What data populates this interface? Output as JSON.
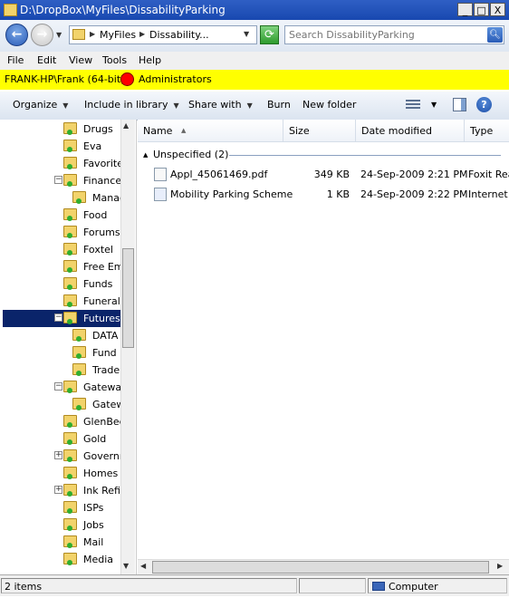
{
  "window": {
    "title": "D:\\DropBox\\MyFiles\\DissabilityParking",
    "minimize_label": "_",
    "maximize_label": "□",
    "close_label": "X"
  },
  "address": {
    "back_glyph": "←",
    "forward_glyph": "→",
    "crumbs": [
      "MyFiles",
      "Dissability..."
    ],
    "search_placeholder": "Search DissabilityParking"
  },
  "menu": [
    "File",
    "Edit",
    "View",
    "Tools",
    "Help"
  ],
  "userbar": {
    "user": "FRANK-HP\\Frank (64-bit)",
    "group": "Administrators",
    "dot_color": "#ff0000"
  },
  "toolbar": {
    "organize": "Organize",
    "include": "Include in library",
    "share": "Share with",
    "burn": "Burn",
    "new_folder": "New folder",
    "help_glyph": "?"
  },
  "tree": [
    {
      "label": "Drugs"
    },
    {
      "label": "Eva"
    },
    {
      "label": "Favorite"
    },
    {
      "label": "Finance",
      "expander": "−"
    },
    {
      "label": "Manag"
    },
    {
      "label": "Food"
    },
    {
      "label": "Forums"
    },
    {
      "label": "Foxtel"
    },
    {
      "label": "Free Em"
    },
    {
      "label": "Funds"
    },
    {
      "label": "Funerals"
    },
    {
      "label": "Futures",
      "expander": "−",
      "selected": true
    },
    {
      "label": "DATA"
    },
    {
      "label": "Fund M"
    },
    {
      "label": "Trader"
    },
    {
      "label": "Gateway",
      "expander": "−"
    },
    {
      "label": "Gatew"
    },
    {
      "label": "GlenBeck"
    },
    {
      "label": "Gold"
    },
    {
      "label": "Governm",
      "expander": "+"
    },
    {
      "label": "Homes"
    },
    {
      "label": "Ink Refill",
      "expander": "+"
    },
    {
      "label": "ISPs"
    },
    {
      "label": "Jobs"
    },
    {
      "label": "Mail"
    },
    {
      "label": "Media"
    }
  ],
  "columns": {
    "name": "Name",
    "size": "Size",
    "date": "Date modified",
    "type": "Type"
  },
  "group": {
    "label": "Unspecified (2)"
  },
  "files": [
    {
      "name": "Appl_45061469.pdf",
      "size": "349 KB",
      "date": "24-Sep-2009 2:21 PM",
      "type": "Foxit Rea"
    },
    {
      "name": "Mobility Parking Scheme",
      "size": "1 KB",
      "date": "24-Sep-2009 2:22 PM",
      "type": "Internet"
    }
  ],
  "status": {
    "items": "2 items",
    "location": "Computer"
  }
}
